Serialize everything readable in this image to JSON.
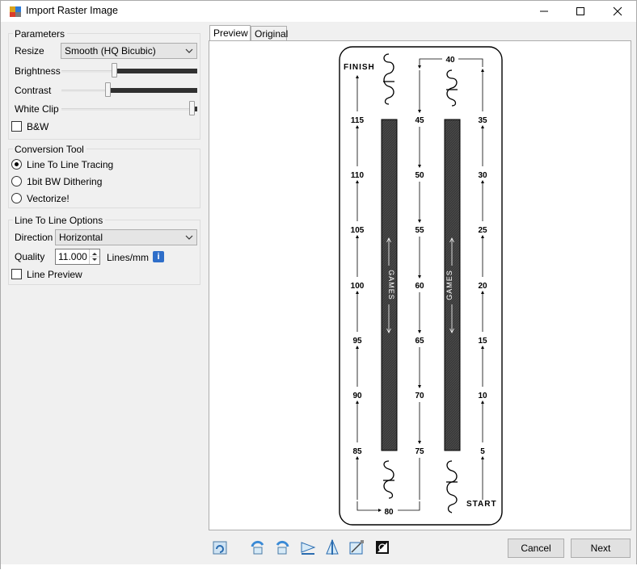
{
  "window": {
    "title": "Import Raster Image",
    "controls": {
      "minimize": "minimize",
      "maximize": "maximize",
      "close": "close"
    }
  },
  "parameters": {
    "title": "Parameters",
    "resize_label": "Resize",
    "resize_value": "Smooth (HQ Bicubic)",
    "brightness_label": "Brightness",
    "brightness_level": 0.35,
    "contrast_label": "Contrast",
    "contrast_level": 0.34,
    "whiteclip_label": "White Clip",
    "whiteclip_level": 0.97,
    "bw_label": "B&W",
    "bw_checked": false
  },
  "conversion": {
    "title": "Conversion Tool",
    "options": [
      "Line To Line Tracing",
      "1bit BW Dithering",
      "Vectorize!"
    ],
    "selected": 0
  },
  "line_options": {
    "title": "Line To Line Options",
    "direction_label": "Direction",
    "direction_value": "Horizontal",
    "quality_label": "Quality",
    "quality_value": "11.000",
    "quality_unit": "Lines/mm",
    "info_icon": "i",
    "line_preview_label": "Line Preview",
    "line_preview_checked": false
  },
  "tabs": [
    {
      "label": "Preview",
      "active": true
    },
    {
      "label": "Original",
      "active": false
    }
  ],
  "board": {
    "finish": "FINISH",
    "start": "START",
    "top_value": "40",
    "bottom_value": "80",
    "track_text": "GAMES",
    "left_column": [
      "115",
      "110",
      "105",
      "100",
      "95",
      "90",
      "85"
    ],
    "middle_column": [
      "45",
      "50",
      "55",
      "60",
      "65",
      "70",
      "75"
    ],
    "right_column": [
      "35",
      "30",
      "25",
      "20",
      "15",
      "10",
      "5"
    ]
  },
  "toolbar_icons": [
    "reload-icon",
    "rotate-left-icon",
    "rotate-right-icon",
    "flip-horizontal-icon",
    "flip-vertical-icon",
    "crop-icon",
    "invert-icon"
  ],
  "buttons": {
    "cancel": "Cancel",
    "next": "Next"
  }
}
